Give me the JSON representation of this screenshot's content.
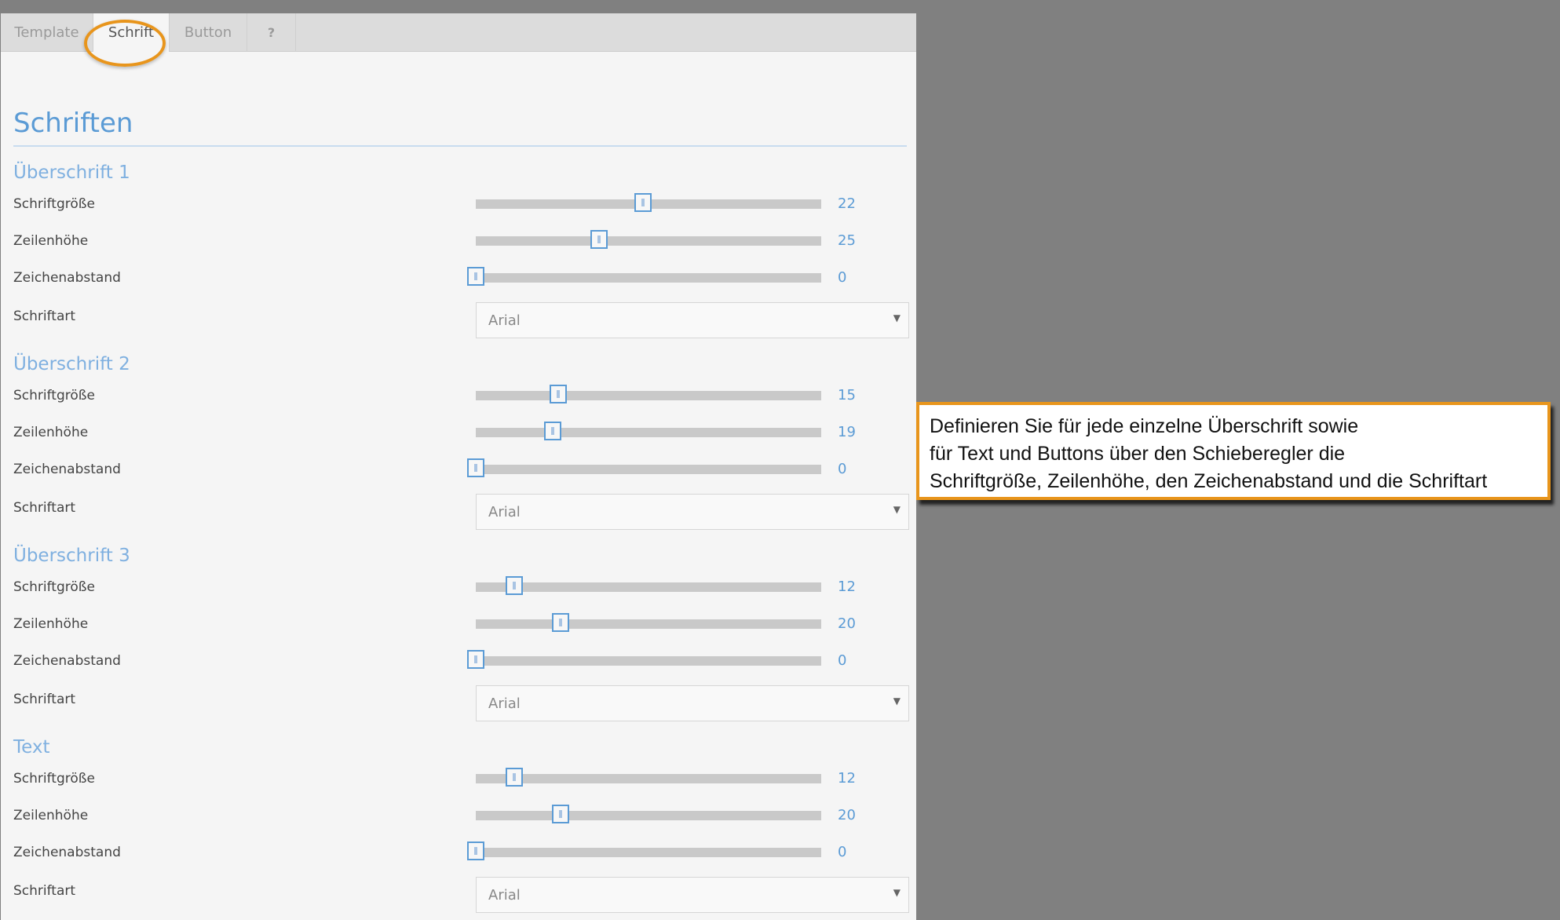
{
  "tabs": [
    {
      "label": "Template",
      "width": 118
    },
    {
      "label": "Schrift",
      "width": 97,
      "active": true
    },
    {
      "label": "Button",
      "width": 99
    },
    {
      "label": "?",
      "width": 62
    }
  ],
  "page_title": "Schriften",
  "labels": {
    "font_size": "Schriftgröße",
    "line_height": "Zeilenhöhe",
    "letter_spacing": "Zeichenabstand",
    "font_family": "Schriftart"
  },
  "sections": [
    {
      "heading": "Überschrift 1",
      "font_size": 22,
      "line_height": 25,
      "letter_spacing": 0,
      "font_family": "Arial"
    },
    {
      "heading": "Überschrift 2",
      "font_size": 15,
      "line_height": 19,
      "letter_spacing": 0,
      "font_family": "Arial"
    },
    {
      "heading": "Überschrift 3",
      "font_size": 12,
      "line_height": 20,
      "letter_spacing": 0,
      "font_family": "Arial"
    },
    {
      "heading": "Text",
      "font_size": 12,
      "line_height": 20,
      "letter_spacing": 0,
      "font_family": "Arial"
    }
  ],
  "slider_fraction": {
    "font_size": [
      0.485,
      0.239,
      0.112,
      0.112
    ],
    "line_height": [
      0.357,
      0.222,
      0.245,
      0.245
    ],
    "letter_spacing": [
      0,
      0,
      0,
      0
    ]
  },
  "callout_lines": [
    "Definieren Sie für jede einzelne Überschrift sowie",
    "für Text und Buttons über den Schieberegler die",
    "Schriftgröße, Zeilenhöhe, den Zeichenabstand und die Schriftart"
  ],
  "colors": {
    "accent": "#5b9bd5",
    "highlight": "#e8951c",
    "background": "#808080"
  }
}
